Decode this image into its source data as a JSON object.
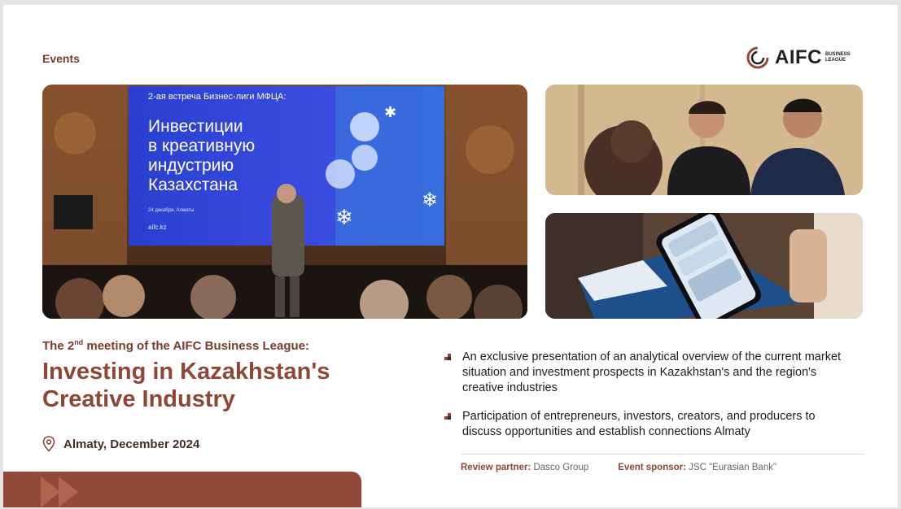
{
  "header": {
    "section": "Events",
    "logo_text": "AIFC",
    "logo_sub": "BUSINESS LEAGUE"
  },
  "photo_screen": {
    "line1": "2-ая встреча Бизнес-лиги МФЦА:",
    "line2": "Инвестиции",
    "line3": "в креативную",
    "line4": "индустрию",
    "line5": "Казахстана",
    "date": "24 декабря, Алматы",
    "url": "aifc.kz"
  },
  "event": {
    "subtitle_pre": "The 2",
    "subtitle_sup": "nd",
    "subtitle_post": " meeting of the AIFC Business League:",
    "headline": "Investing in Kazakhstan's Creative Industry",
    "location": "Almaty, December 2024"
  },
  "bullets": [
    "An exclusive presentation of an analytical overview of the current market situation and investment prospects in Kazakhstan's and the region's creative industries",
    "Participation of entrepreneurs, investors, creators, and producers to discuss opportunities and establish connections Almaty"
  ],
  "credits": {
    "review_label": "Review partner:",
    "review_value": "Dasco Group",
    "sponsor_label": "Event sponsor:",
    "sponsor_value": "JSC \"Eurasian Bank\""
  },
  "colors": {
    "brand": "#8e4636",
    "brand_dark": "#7a3a2c",
    "footer_bar": "#93493a"
  }
}
